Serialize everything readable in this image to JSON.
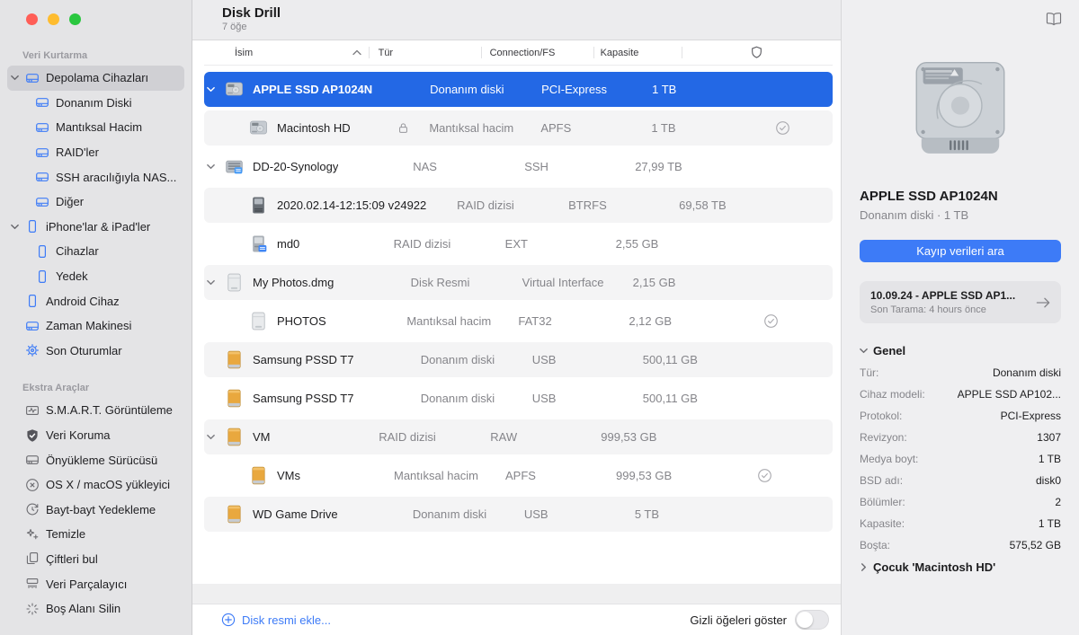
{
  "header": {
    "title": "Disk Drill",
    "subtitle": "7 öğe"
  },
  "colors": {
    "accent_blue": "#3d7bf7",
    "selection_blue": "#2368e5",
    "drive_orange": "#e9a83e",
    "sidebar_bg": "#e4e4e6",
    "panel_bg": "#efeff1"
  },
  "sidebar": {
    "sections": [
      {
        "label": "Veri Kurtarma",
        "items": [
          {
            "label": "Depolama Cihazları",
            "icon": "drive",
            "tint": "blue",
            "indent": 0,
            "expanded": true,
            "selected": true
          },
          {
            "label": "Donanım Diski",
            "icon": "drive",
            "tint": "blue",
            "indent": 1
          },
          {
            "label": "Mantıksal Hacim",
            "icon": "drive",
            "tint": "blue",
            "indent": 1
          },
          {
            "label": "RAID'ler",
            "icon": "drive",
            "tint": "blue",
            "indent": 1
          },
          {
            "label": "SSH aracılığıyla NAS...",
            "icon": "drive",
            "tint": "blue",
            "indent": 1
          },
          {
            "label": "Diğer",
            "icon": "drive",
            "tint": "blue",
            "indent": 1
          },
          {
            "label": "iPhone'lar & iPad'ler",
            "icon": "phone",
            "tint": "blue",
            "indent": 0,
            "expanded": true
          },
          {
            "label": "Cihazlar",
            "icon": "phone",
            "tint": "blue",
            "indent": 1
          },
          {
            "label": "Yedek",
            "icon": "phone",
            "tint": "blue",
            "indent": 1
          },
          {
            "label": "Android Cihaz",
            "icon": "phone",
            "tint": "blue",
            "indent": 0
          },
          {
            "label": "Zaman Makinesi",
            "icon": "drive",
            "tint": "blue",
            "indent": 0
          },
          {
            "label": "Son Oturumlar",
            "icon": "gear",
            "tint": "blue",
            "indent": 0
          }
        ]
      },
      {
        "label": "Ekstra Araçlar",
        "items": [
          {
            "label": "S.M.A.R.T. Görüntüleme",
            "icon": "smart-monitor",
            "tint": "gray",
            "indent": 0
          },
          {
            "label": "Veri Koruma",
            "icon": "shield-check-filled",
            "tint": "gray",
            "indent": 0
          },
          {
            "label": "Önyükleme Sürücüsü",
            "icon": "drive",
            "tint": "gray",
            "indent": 0
          },
          {
            "label": "OS X / macOS yükleyici",
            "icon": "circle-x",
            "tint": "gray",
            "indent": 0
          },
          {
            "label": "Bayt-bayt Yedekleme",
            "icon": "history-clock",
            "tint": "gray",
            "indent": 0
          },
          {
            "label": "Temizle",
            "icon": "sparkle",
            "tint": "gray",
            "indent": 0
          },
          {
            "label": "Çiftleri bul",
            "icon": "duplicate",
            "tint": "gray",
            "indent": 0
          },
          {
            "label": "Veri Parçalayıcı",
            "icon": "shredder",
            "tint": "gray",
            "indent": 0
          },
          {
            "label": "Boş Alanı Silin",
            "icon": "burst",
            "tint": "gray",
            "indent": 0
          }
        ]
      }
    ]
  },
  "table": {
    "columns": {
      "name": "İsim",
      "type": "Tür",
      "connection": "Connection/FS",
      "capacity": "Kapasite"
    },
    "rows": [
      {
        "name": "APPLE SSD AP1024N",
        "type": "Donanım diski",
        "connection": "PCI-Express",
        "capacity": "1 TB",
        "icon": "internal-drive",
        "indent": 0,
        "expandable": true,
        "selected": true
      },
      {
        "name": "Macintosh HD",
        "type": "Mantıksal hacim",
        "connection": "APFS",
        "capacity": "1 TB",
        "icon": "internal-drive",
        "indent": 1,
        "locked": true,
        "protected": true
      },
      {
        "name": "DD-20-Synology",
        "type": "NAS",
        "connection": "SSH",
        "capacity": "27,99 TB",
        "icon": "nas-server",
        "indent": 0,
        "expandable": true
      },
      {
        "name": "2020.02.14-12:15:09 v24922",
        "type": "RAID dizisi",
        "connection": "BTRFS",
        "capacity": "69,58 TB",
        "icon": "raid-dark-drive",
        "indent": 1
      },
      {
        "name": "md0",
        "type": "RAID dizisi",
        "connection": "EXT",
        "capacity": "2,55 GB",
        "icon": "raid-badge-drive",
        "indent": 1
      },
      {
        "name": "My Photos.dmg",
        "type": "Disk Resmi",
        "connection": "Virtual Interface",
        "capacity": "2,15 GB",
        "icon": "disk-image",
        "indent": 0,
        "expandable": true
      },
      {
        "name": "PHOTOS",
        "type": "Mantıksal hacim",
        "connection": "FAT32",
        "capacity": "2,12 GB",
        "icon": "disk-image",
        "indent": 1,
        "protected": true
      },
      {
        "name": "Samsung PSSD T7",
        "type": "Donanım diski",
        "connection": "USB",
        "capacity": "500,11 GB",
        "icon": "external-orange-drive",
        "indent": 0
      },
      {
        "name": "Samsung PSSD T7",
        "type": "Donanım diski",
        "connection": "USB",
        "capacity": "500,11 GB",
        "icon": "external-orange-drive",
        "indent": 0
      },
      {
        "name": "VM",
        "type": "RAID dizisi",
        "connection": "RAW",
        "capacity": "999,53 GB",
        "icon": "external-orange-drive",
        "indent": 0,
        "expandable": true
      },
      {
        "name": "VMs",
        "type": "Mantıksal hacim",
        "connection": "APFS",
        "capacity": "999,53 GB",
        "icon": "external-orange-drive",
        "indent": 1,
        "protected": true
      },
      {
        "name": "WD Game Drive",
        "type": "Donanım diski",
        "connection": "USB",
        "capacity": "5 TB",
        "icon": "external-orange-drive",
        "indent": 0
      }
    ]
  },
  "footer": {
    "add_disk_image": "Disk resmi ekle...",
    "show_hidden": "Gizli öğeleri göster",
    "show_hidden_state": "off"
  },
  "details": {
    "title": "APPLE SSD AP1024N",
    "subtitle": "Donanım diski · 1 TB",
    "scan_button": "Kayıp verileri ara",
    "last_scan": {
      "title": "10.09.24 - APPLE SSD AP1...",
      "subtitle": "Son Tarama: 4 hours önce"
    },
    "section_general": "Genel",
    "properties": [
      {
        "label": "Tür:",
        "value": "Donanım diski"
      },
      {
        "label": "Cihaz modeli:",
        "value": "APPLE SSD AP102..."
      },
      {
        "label": "Protokol:",
        "value": "PCI-Express"
      },
      {
        "label": "Revizyon:",
        "value": "1307"
      },
      {
        "label": "Medya boyt:",
        "value": "1 TB"
      },
      {
        "label": "BSD adı:",
        "value": "disk0"
      },
      {
        "label": "Bölümler:",
        "value": "2"
      },
      {
        "label": "Kapasite:",
        "value": "1 TB"
      },
      {
        "label": "Boşta:",
        "value": "575,52 GB"
      }
    ],
    "child_row": "Çocuk 'Macintosh HD'"
  }
}
